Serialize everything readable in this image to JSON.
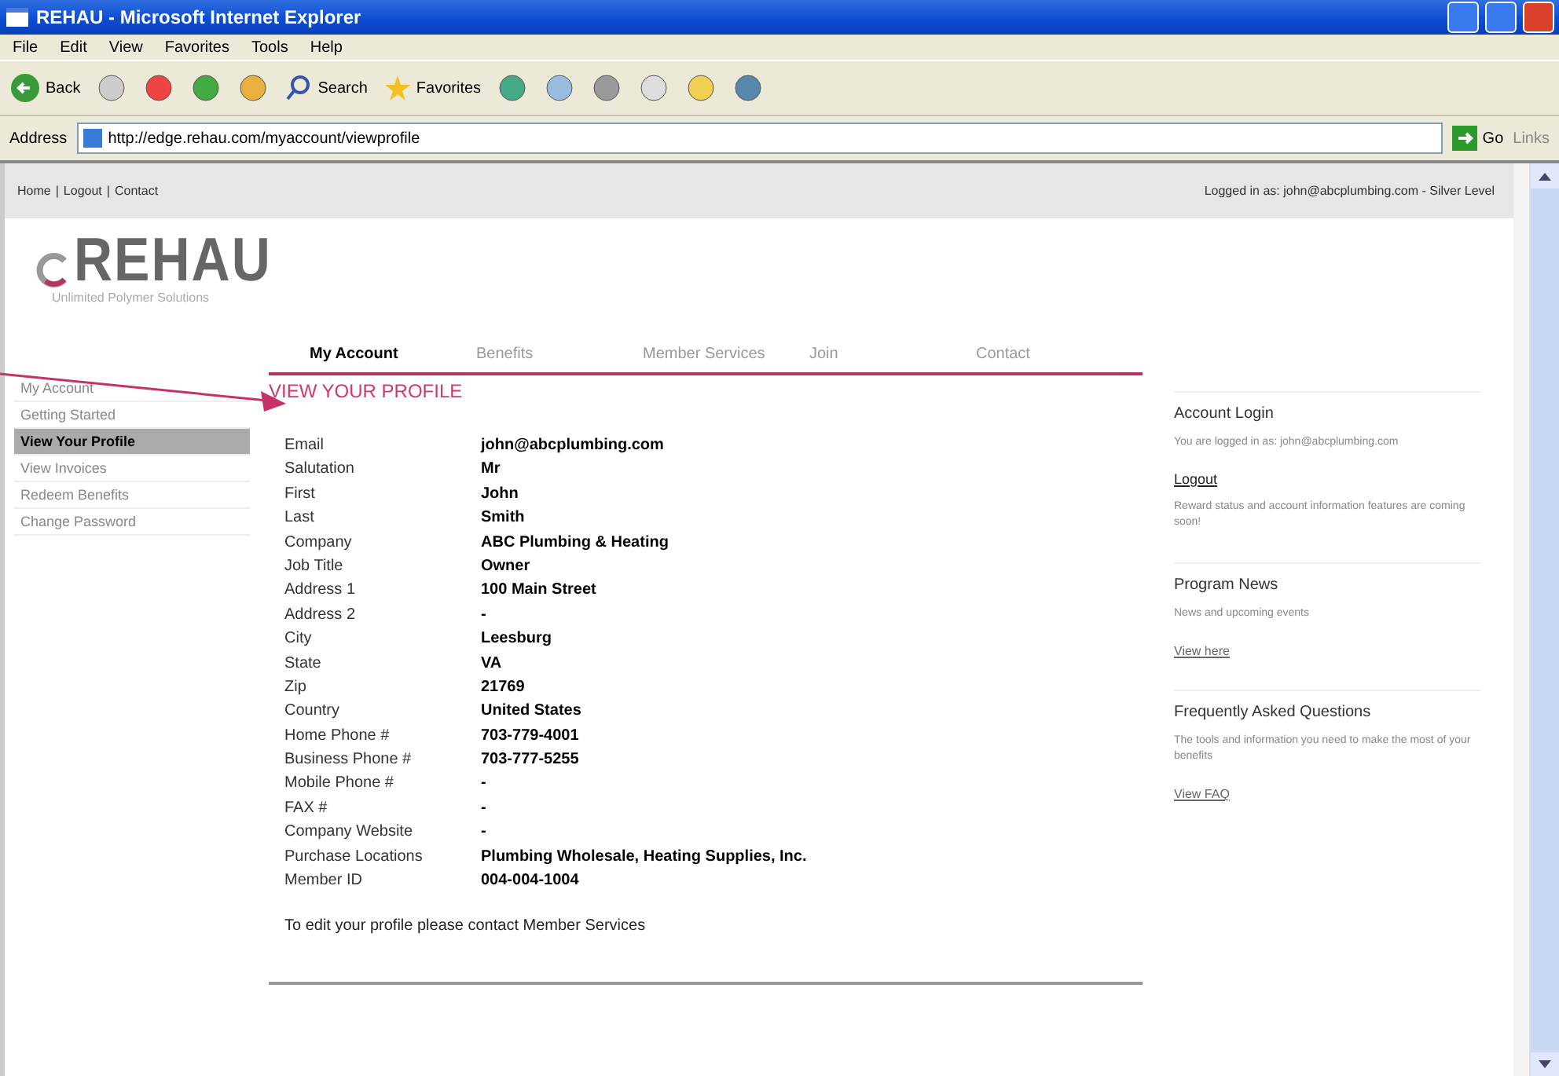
{
  "window": {
    "title": "REHAU - Microsoft Internet Explorer"
  },
  "menu": [
    "File",
    "Edit",
    "View",
    "Favorites",
    "Tools",
    "Help"
  ],
  "toolbar": {
    "back": "Back",
    "search": "Search",
    "favorites": "Favorites"
  },
  "address_bar": {
    "label": "Address",
    "url": "http://edge.rehau.com/myaccount/viewprofile",
    "go": "Go",
    "links": "Links"
  },
  "top_bar": {
    "links": [
      "Home",
      "Logout",
      "Contact"
    ],
    "separator": "|",
    "login_status": "Logged in as: john@abcplumbing.com - Silver Level"
  },
  "logo": {
    "name": "REHAU",
    "tagline": "Unlimited Polymer Solutions"
  },
  "tabs": [
    {
      "label": "My Account",
      "selected": true
    },
    {
      "label": "Benefits",
      "selected": false
    },
    {
      "label": "Member Services",
      "selected": false
    },
    {
      "label": "Join",
      "selected": false
    },
    {
      "label": "Contact",
      "selected": false
    }
  ],
  "sidebar": {
    "items": [
      {
        "label": "My Account",
        "selected": false
      },
      {
        "label": "Getting Started",
        "selected": false
      },
      {
        "label": "View Your Profile",
        "selected": true
      },
      {
        "label": "View Invoices",
        "selected": false
      },
      {
        "label": "Redeem Benefits",
        "selected": false
      },
      {
        "label": "Change Password",
        "selected": false
      }
    ]
  },
  "profile": {
    "heading": "VIEW YOUR PROFILE",
    "fields": [
      {
        "label": "Email",
        "value": "john@abcplumbing.com"
      },
      {
        "label": "Salutation",
        "value": "Mr"
      },
      {
        "label": "First",
        "value": "John"
      },
      {
        "label": "Last",
        "value": "Smith"
      },
      {
        "label": "Company",
        "value": "ABC Plumbing & Heating"
      },
      {
        "label": "Job Title",
        "value": "Owner"
      },
      {
        "label": "Address 1",
        "value": "100 Main Street"
      },
      {
        "label": "Address 2",
        "value": "-"
      },
      {
        "label": "City",
        "value": "Leesburg"
      },
      {
        "label": "State",
        "value": "VA"
      },
      {
        "label": "Zip",
        "value": "21769"
      },
      {
        "label": "Country",
        "value": "United States"
      },
      {
        "label": "Home Phone #",
        "value": "703-779-4001"
      },
      {
        "label": "Business Phone #",
        "value": "703-777-5255"
      },
      {
        "label": "Mobile Phone #",
        "value": "-"
      },
      {
        "label": "FAX #",
        "value": "-"
      },
      {
        "label": "Company Website",
        "value": "-"
      },
      {
        "label": "Purchase Locations",
        "value": "Plumbing Wholesale, Heating Supplies, Inc."
      },
      {
        "label": "Member ID",
        "value": "004-004-1004"
      }
    ],
    "edit_note": "To edit your profile please contact",
    "edit_link": "Member Services"
  },
  "right_panel": [
    {
      "title": "Account Login",
      "texts": [
        "You are logged in as: john@abcplumbing.com"
      ],
      "link": "Logout",
      "after": "Reward status and account information features are coming soon!"
    },
    {
      "title": "Program News",
      "texts": [
        "News and upcoming events"
      ],
      "link": "View here"
    },
    {
      "title": "Frequently Asked Questions",
      "texts": [
        "The tools and information you need to make the most of your benefits"
      ],
      "link": "View FAQ"
    }
  ]
}
